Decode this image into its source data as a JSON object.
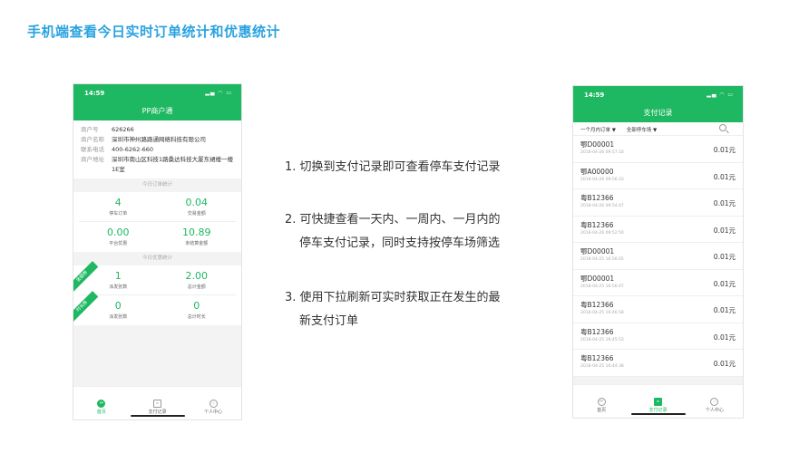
{
  "slide_title": "手机端查看今日实时订单统计和优惠统计",
  "colors": {
    "accent": "#1fb862",
    "title": "#2aa3e0"
  },
  "left_phone": {
    "time": "14:59",
    "app_title": "PP商户通",
    "info": [
      {
        "k": "商户号",
        "v": "626266"
      },
      {
        "k": "商户名称",
        "v": "深圳市神州路路通网络科技有限公司"
      },
      {
        "k": "联系电话",
        "v": "400-6262-660"
      },
      {
        "k": "商户地址",
        "v": "深圳市南山区科技1路桑达科技大厦东裙楼一楼1E室"
      }
    ],
    "today_title": "今日订单统计",
    "today": [
      {
        "value": "4",
        "label": "停车订单"
      },
      {
        "value": "0.04",
        "label": "交易金额"
      },
      {
        "value": "0.00",
        "label": "平台优惠"
      },
      {
        "value": "10.89",
        "label": "未结算金额"
      }
    ],
    "coupon_title": "今日优惠统计",
    "ribbons": [
      "金额券",
      "时长券"
    ],
    "coupon": [
      {
        "value": "1",
        "label": "派发张数"
      },
      {
        "value": "2.00",
        "label": "总计金额"
      },
      {
        "value": "0",
        "label": "派发张数"
      },
      {
        "value": "0",
        "label": "总计时长"
      }
    ],
    "tabs": [
      {
        "label": "首页",
        "icon": "pp-logo-icon",
        "glyph": "PP"
      },
      {
        "label": "支付记录",
        "icon": "receipt-icon",
        "glyph": "≡"
      },
      {
        "label": "个人中心",
        "icon": "user-icon",
        "glyph": "○"
      }
    ]
  },
  "right_phone": {
    "time": "14:59",
    "app_title": "支付记录",
    "filter_period": "一个月内订单 ▼",
    "filter_lot": "全部停车场 ▼",
    "records": [
      {
        "plate": "鄂D00001",
        "time": "2018-04-26 09:57:18",
        "amount": "0.01元"
      },
      {
        "plate": "鄂A00000",
        "time": "2018-04-26 09:56:33",
        "amount": "0.01元"
      },
      {
        "plate": "粤B12366",
        "time": "2018-04-26 09:54:47",
        "amount": "0.01元"
      },
      {
        "plate": "粤B12366",
        "time": "2018-04-26 09:52:50",
        "amount": "0.01元"
      },
      {
        "plate": "鄂D00001",
        "time": "2018-04-25 16:56:05",
        "amount": "0.01元"
      },
      {
        "plate": "鄂D00001",
        "time": "2018-04-25 16:56:47",
        "amount": "0.01元"
      },
      {
        "plate": "粤B12366",
        "time": "2018-04-25 16:46:58",
        "amount": "0.01元"
      },
      {
        "plate": "粤B12366",
        "time": "2018-04-25 16:45:53",
        "amount": "0.01元"
      },
      {
        "plate": "粤B12366",
        "time": "2018-04-25 16:44:38",
        "amount": "0.01元"
      }
    ],
    "tabs": [
      {
        "label": "首页",
        "icon": "pp-logo-icon",
        "glyph": "PP"
      },
      {
        "label": "支付记录",
        "icon": "receipt-icon",
        "glyph": "≡"
      },
      {
        "label": "个人中心",
        "icon": "user-icon",
        "glyph": "○"
      }
    ]
  },
  "steps": [
    {
      "num": "1.",
      "text": "切换到支付记录即可查看停车支付记录",
      "cont": ""
    },
    {
      "num": "2.",
      "text": "可快捷查看一天内、一周内、一月内的",
      "cont": "停车支付记录，同时支持按停车场筛选"
    },
    {
      "num": "3.",
      "text": "使用下拉刷新可实时获取正在发生的最",
      "cont": "新支付订单"
    }
  ]
}
